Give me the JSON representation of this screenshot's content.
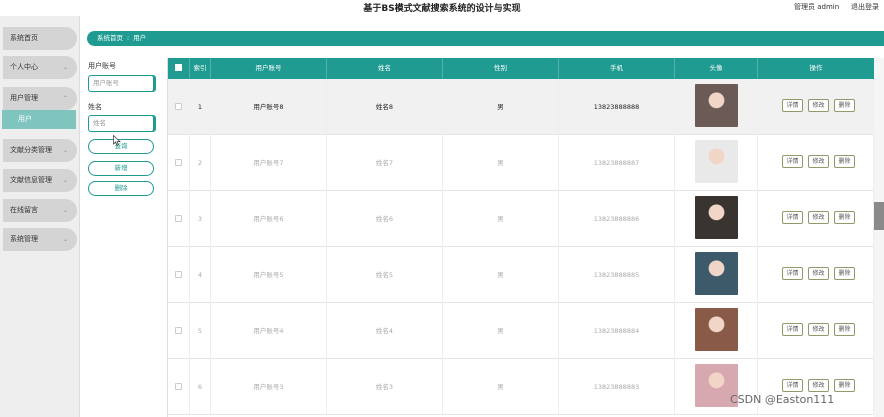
{
  "header": {
    "title": "基于BS模式文献搜索系统的设计与实现",
    "user": "管理员 admin",
    "logout": "退出登录"
  },
  "sidebar": {
    "items": [
      {
        "label": "系统首页",
        "chevron": ""
      },
      {
        "label": "个人中心",
        "chevron": "⌄"
      },
      {
        "label": "用户管理",
        "chevron": "⌃"
      },
      {
        "label": "文献分类管理",
        "chevron": "⌄"
      },
      {
        "label": "文献信息管理",
        "chevron": "⌄"
      },
      {
        "label": "在线留言",
        "chevron": "⌄"
      },
      {
        "label": "系统管理",
        "chevron": "⌄"
      }
    ],
    "active_sub": "用户"
  },
  "breadcrumb": {
    "home": "系统首页",
    "separator": "⁝",
    "current": "用户"
  },
  "search": {
    "account_label": "用户账号",
    "account_placeholder": "用户账号",
    "name_label": "姓名",
    "name_placeholder": "姓名",
    "query_button": "查询",
    "add_button": "新增",
    "delete_button": "删除"
  },
  "table": {
    "columns": [
      "",
      "索引",
      "用户账号",
      "姓名",
      "性别",
      "手机",
      "头像",
      "操作"
    ],
    "actions": [
      "详情",
      "修改",
      "删除"
    ],
    "rows": [
      {
        "index": "1",
        "account": "用户账号8",
        "name": "姓名8",
        "gender": "男",
        "phone": "13823888888",
        "avatar_color": "#6b5a55"
      },
      {
        "index": "2",
        "account": "用户账号7",
        "name": "姓名7",
        "gender": "男",
        "phone": "13823888887",
        "avatar_color": "#e9e9e9"
      },
      {
        "index": "3",
        "account": "用户账号6",
        "name": "姓名6",
        "gender": "男",
        "phone": "13823888886",
        "avatar_color": "#3a3430"
      },
      {
        "index": "4",
        "account": "用户账号5",
        "name": "姓名5",
        "gender": "男",
        "phone": "13823888885",
        "avatar_color": "#3d5a6b"
      },
      {
        "index": "5",
        "account": "用户账号4",
        "name": "姓名4",
        "gender": "男",
        "phone": "13823888884",
        "avatar_color": "#8a5a48"
      },
      {
        "index": "6",
        "account": "用户账号3",
        "name": "姓名3",
        "gender": "男",
        "phone": "13823888883",
        "avatar_color": "#d8a8b0"
      }
    ]
  },
  "colors": {
    "accent": "#1f9b92",
    "submenu_active": "#7fc4bf"
  },
  "watermark": "CSDN @Easton111"
}
